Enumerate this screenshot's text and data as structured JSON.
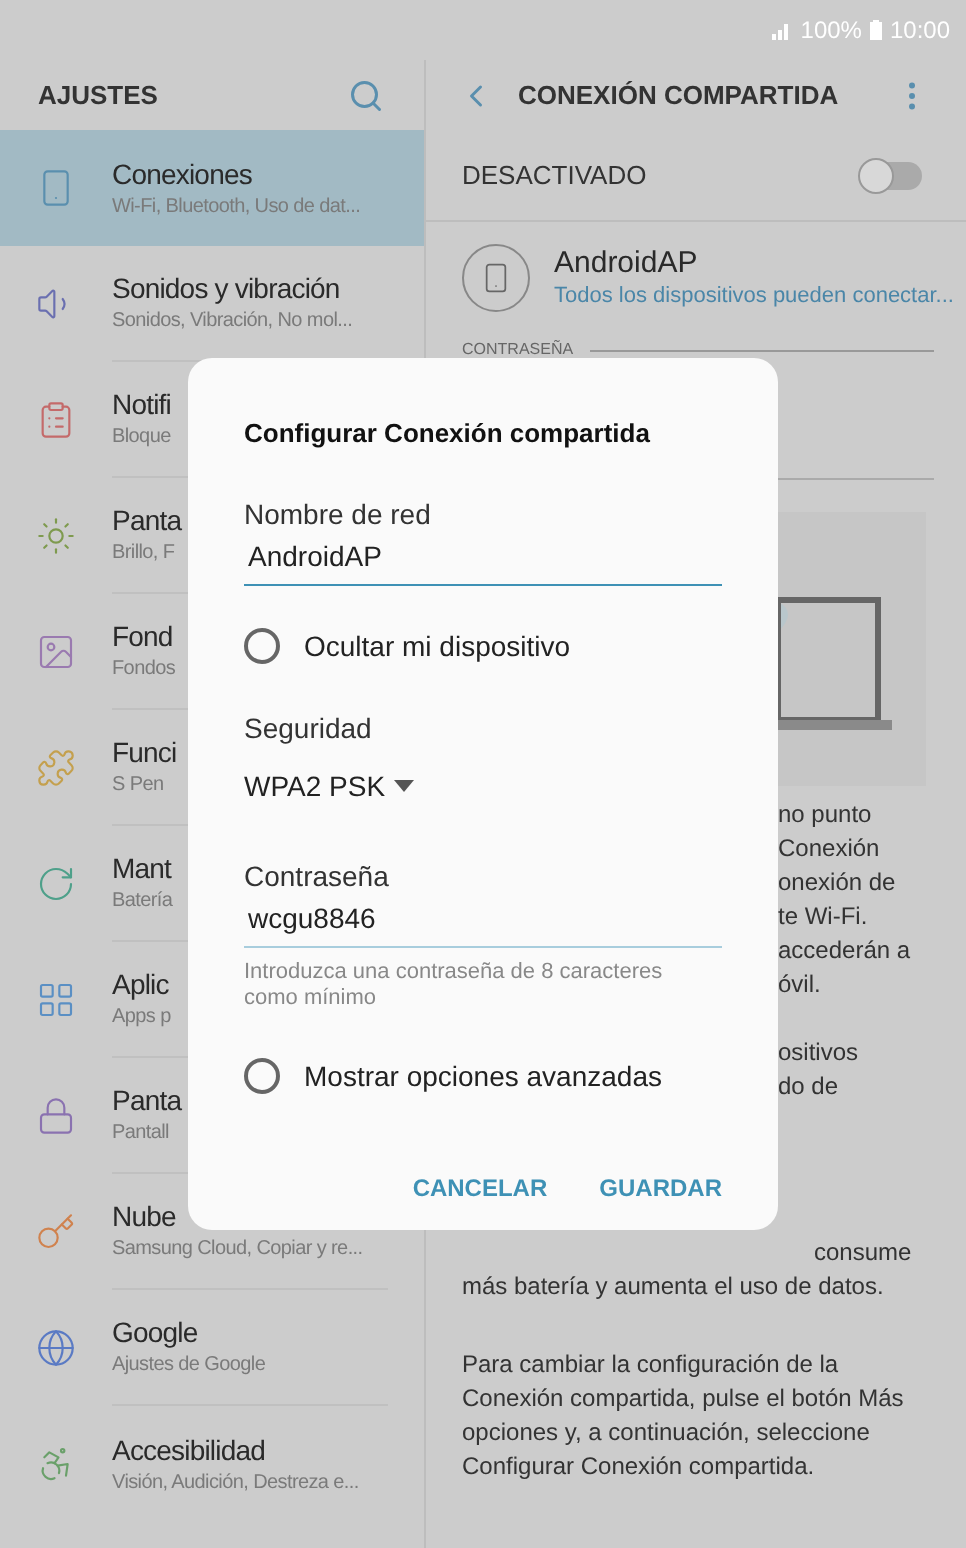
{
  "status_bar": {
    "battery": "100%",
    "time": "10:00"
  },
  "left_header": {
    "title": "AJUSTES"
  },
  "settings_items": [
    {
      "title": "Conexiones",
      "subtitle": "Wi-Fi, Bluetooth, Uso de dat...",
      "selected": true,
      "color": "#5a8fae"
    },
    {
      "title": "Sonidos y vibración",
      "subtitle": "Sonidos, Vibración, No mol...",
      "selected": false,
      "color": "#6a6fb0"
    },
    {
      "title": "Notifi",
      "subtitle": "Bloque",
      "selected": false,
      "color": "#c46a6a"
    },
    {
      "title": "Panta",
      "subtitle": "Brillo, F",
      "selected": false,
      "color": "#7e9a4e"
    },
    {
      "title": "Fond",
      "subtitle": "Fondos",
      "selected": false,
      "color": "#9a7ab0"
    },
    {
      "title": "Funci",
      "subtitle": "S Pen",
      "selected": false,
      "color": "#c4a04e"
    },
    {
      "title": "Mant",
      "subtitle": "Batería",
      "selected": false,
      "color": "#4ea08a"
    },
    {
      "title": "Aplic",
      "subtitle": "Apps p",
      "selected": false,
      "color": "#5a8fc4"
    },
    {
      "title": "Panta",
      "subtitle": "Pantall",
      "selected": false,
      "color": "#8a72b0"
    },
    {
      "title": "Nube",
      "subtitle": "Samsung Cloud, Copiar y re...",
      "selected": false,
      "color": "#d0824e"
    },
    {
      "title": "Google",
      "subtitle": "Ajustes de Google",
      "selected": false,
      "color": "#5a7ac4"
    },
    {
      "title": "Accesibilidad",
      "subtitle": "Visión, Audición, Destreza e...",
      "selected": false,
      "color": "#6aa06a"
    }
  ],
  "right_header": {
    "title": "CONEXIÓN COMPARTIDA"
  },
  "switch_row": {
    "label": "DESACTIVADO",
    "on": false
  },
  "network": {
    "name": "AndroidAP",
    "subtitle": "Todos los dispositivos pueden conectar..."
  },
  "section_label": "CONTRASEÑA",
  "description_lines": [
    "no punto",
    "Conexión",
    "onexión de",
    "te Wi-Fi.",
    "accederán a",
    "óvil."
  ],
  "description_lines_2": [
    "ositivos",
    "do de"
  ],
  "usage_lines": [
    "consume",
    "más batería y aumenta el uso de datos."
  ],
  "help_text": "Para cambiar la configuración de la Conexión compartida, pulse el botón Más opciones y, a continuación, seleccione Configurar Conexión compartida.",
  "dialog": {
    "title": "Configurar Conexión compartida",
    "network_name": {
      "label": "Nombre de red",
      "value": "AndroidAP"
    },
    "hide_device": {
      "label": "Ocultar mi dispositivo",
      "checked": false
    },
    "security": {
      "label": "Seguridad",
      "value": "WPA2 PSK"
    },
    "password": {
      "label": "Contraseña",
      "value": "wcgu8846",
      "hint": "Introduzca una contraseña de 8 caracteres como mínimo"
    },
    "advanced": {
      "label": "Mostrar opciones avanzadas",
      "checked": false
    },
    "buttons": [
      "CANCELAR",
      "GUARDAR"
    ]
  }
}
